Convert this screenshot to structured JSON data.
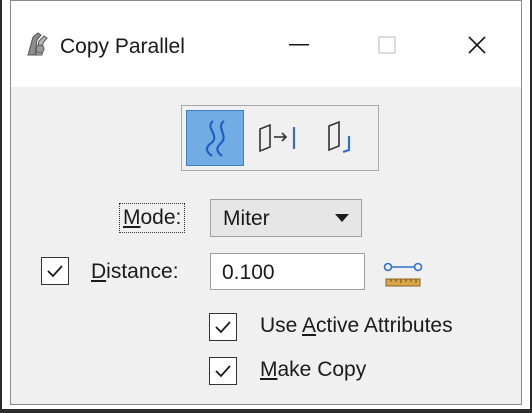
{
  "window": {
    "title": "Copy Parallel"
  },
  "icons": {
    "app": "copy-parallel-app-icon",
    "minimize": "minimize-icon",
    "maximize": "maximize-icon",
    "close": "close-icon",
    "tool_1": "parallel-curves-icon",
    "tool_2": "offset-right-icon",
    "tool_3": "offset-corner-icon",
    "measure": "measure-distance-icon",
    "check": "checkmark-icon"
  },
  "colors": {
    "active_tool_bg": "#73ace4",
    "accent_blue": "#2f6fd0",
    "measure_ruler": "#d9a64a"
  },
  "toolbar": {
    "active_tool": 1
  },
  "form": {
    "mode": {
      "label_pre": "",
      "label_underline": "M",
      "label_post": "ode:",
      "value": "Miter"
    },
    "distance": {
      "checked": true,
      "label_underline": "D",
      "label_post": "istance:",
      "value": "0.100"
    },
    "use_active_attributes": {
      "checked": true,
      "label_pre": "Use ",
      "label_underline": "A",
      "label_post": "ctive Attributes"
    },
    "make_copy": {
      "checked": true,
      "label_underline": "M",
      "label_post": "ake Copy"
    }
  }
}
